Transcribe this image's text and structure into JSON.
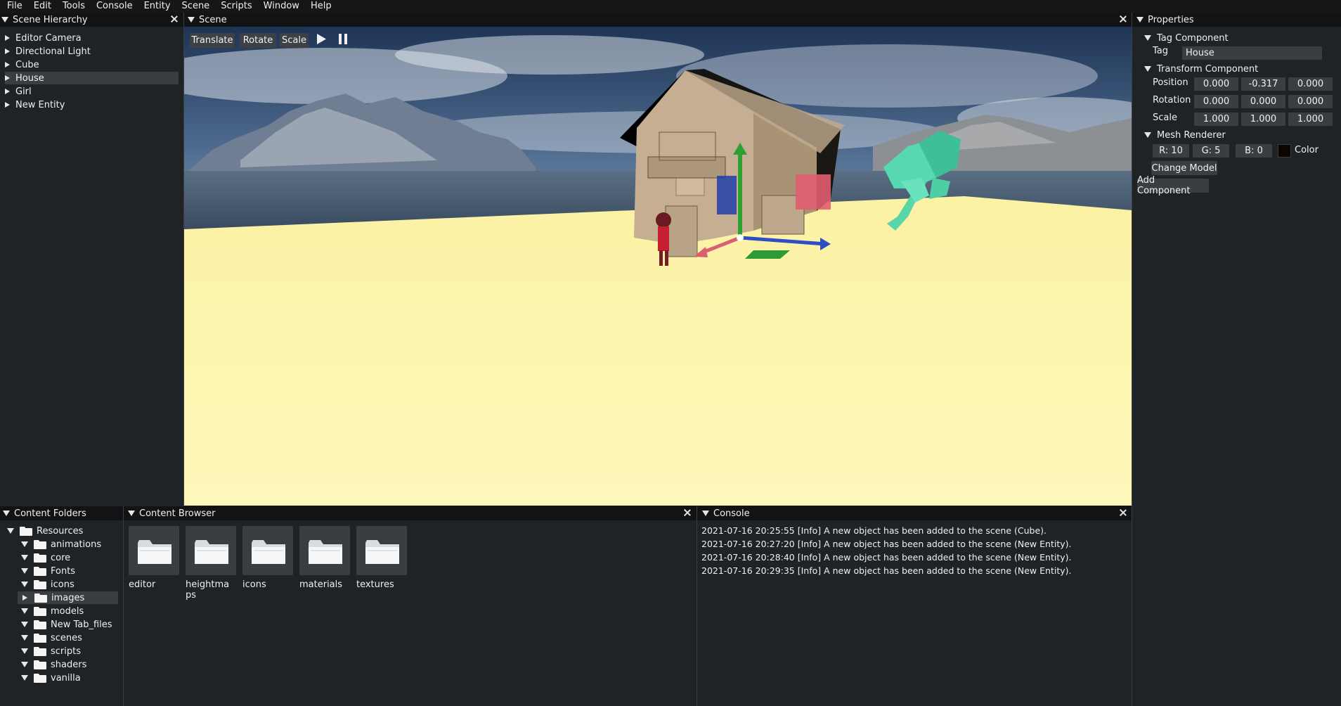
{
  "menu": [
    "File",
    "Edit",
    "Tools",
    "Console",
    "Entity",
    "Scene",
    "Scripts",
    "Window",
    "Help"
  ],
  "hierarchy": {
    "title": "Scene Hierarchy",
    "items": [
      "Editor Camera",
      "Directional Light",
      "Cube",
      "House",
      "Girl",
      "New Entity"
    ],
    "selected": "House"
  },
  "scene": {
    "title": "Scene",
    "toolbar": {
      "translate": "Translate",
      "rotate": "Rotate",
      "scale": "Scale"
    },
    "play_icon": "play-icon",
    "pause_icon": "pause-icon"
  },
  "properties": {
    "title": "Properties",
    "tag_component": "Tag Component",
    "tag_label": "Tag",
    "tag_value": "House",
    "transform_component": "Transform Component",
    "position_label": "Position",
    "position": [
      "0.000",
      "-0.317",
      "0.000"
    ],
    "rotation_label": "Rotation",
    "rotation": [
      "0.000",
      "0.000",
      "0.000"
    ],
    "scale_label": "Scale",
    "scale": [
      "1.000",
      "1.000",
      "1.000"
    ],
    "mesh_renderer": "Mesh Renderer",
    "color_r": "R: 10",
    "color_g": "G: 5",
    "color_b": "B: 0",
    "color_label": "Color",
    "color_swatch": "#0a0500",
    "change_model": "Change Model",
    "add_component": "Add Component"
  },
  "content_folders": {
    "title": "Content Folders",
    "root": "Resources",
    "items": [
      "animations",
      "core",
      "Fonts",
      "icons",
      "images",
      "models",
      "New Tab_files",
      "scenes",
      "scripts",
      "shaders",
      "vanilla"
    ],
    "selected": "images"
  },
  "content_browser": {
    "title": "Content Browser",
    "items": [
      "editor",
      "heightmaps",
      "icons",
      "materials",
      "textures"
    ]
  },
  "console": {
    "title": "Console",
    "lines": [
      "2021-07-16 20:25:55 [Info] A new object has been added to the scene (Cube).",
      "2021-07-16 20:27:20 [Info] A new object has been added to the scene (New Entity).",
      "2021-07-16 20:28:40 [Info] A new object has been added to the scene (New Entity).",
      "2021-07-16 20:29:35 [Info] A new object has been added to the scene (New Entity)."
    ]
  }
}
